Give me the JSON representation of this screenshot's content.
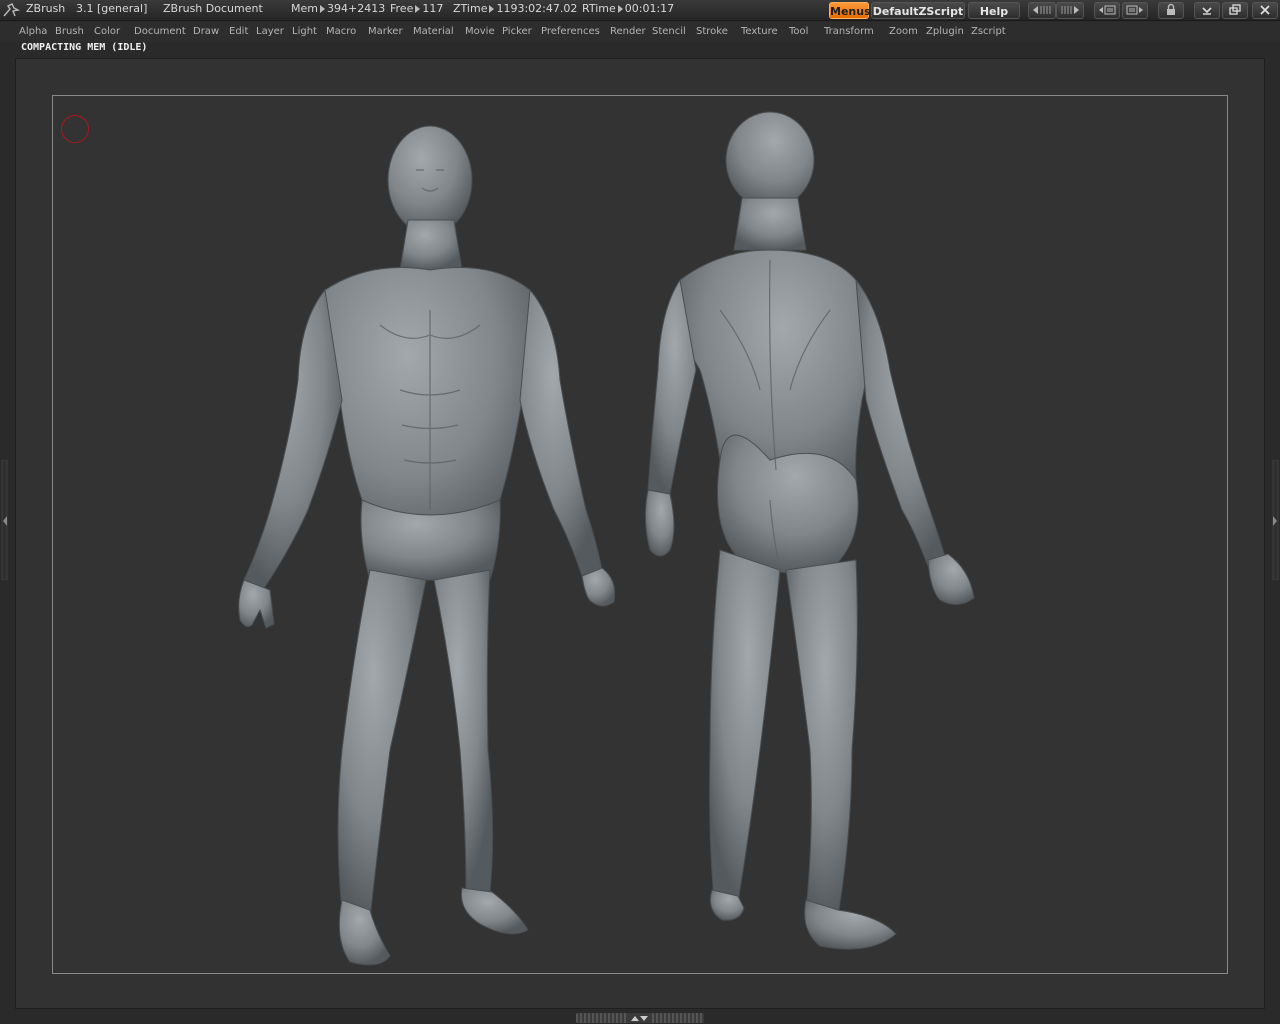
{
  "app": {
    "name": "ZBrush",
    "version": "3.1 [general]",
    "document": "ZBrush Document",
    "mem_label": "Mem",
    "mem_value": "394+2413",
    "free_label": "Free",
    "free_value": "117",
    "ztime_label": "ZTime",
    "ztime_value": "1193:02:47.02",
    "rtime_label": "RTime",
    "rtime_value": "00:01:17"
  },
  "toolbar": {
    "menus_label": "Menus",
    "script_label": "DefaultZScript",
    "help_label": "Help"
  },
  "menu": {
    "items": [
      "Alpha",
      "Brush",
      "Color",
      "Document",
      "Draw",
      "Edit",
      "Layer",
      "Light",
      "Macro",
      "Marker",
      "Material",
      "Movie",
      "Picker",
      "Preferences",
      "Render",
      "Stencil",
      "Stroke",
      "Texture",
      "Tool",
      "Transform",
      "Zoom",
      "Zplugin",
      "Zscript"
    ]
  },
  "status": {
    "text": "COMPACTING MEM (IDLE)"
  },
  "colors": {
    "accent": "#f08020",
    "background": "#2a2a2a",
    "canvas": "#333333",
    "model": "#8a8f93",
    "cursor": "#b01818"
  },
  "icons": {
    "logo": "zbrush-logo-icon",
    "cursor": "brush-cursor-icon"
  }
}
